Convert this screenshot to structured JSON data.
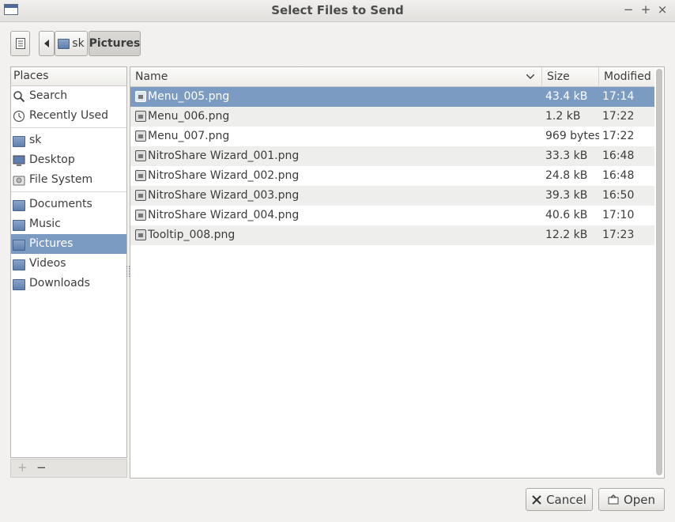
{
  "window": {
    "title": "Select Files to Send",
    "controls": {
      "minimize": "−",
      "maximize": "+",
      "close": "×"
    }
  },
  "toolbar": {
    "location_toggle_icon": "text-entry-icon",
    "back_icon": "left-arrow-icon",
    "path": [
      {
        "label": "sk",
        "icon": "folder-icon"
      },
      {
        "label": "Pictures",
        "active": true
      }
    ]
  },
  "places": {
    "header": "Places",
    "groups": [
      [
        {
          "label": "Search",
          "icon": "search-icon"
        },
        {
          "label": "Recently Used",
          "icon": "clock-icon"
        }
      ],
      [
        {
          "label": "sk",
          "icon": "home-folder-icon"
        },
        {
          "label": "Desktop",
          "icon": "desktop-icon"
        },
        {
          "label": "File System",
          "icon": "drive-icon"
        }
      ],
      [
        {
          "label": "Documents",
          "icon": "folder-icon"
        },
        {
          "label": "Music",
          "icon": "folder-icon"
        },
        {
          "label": "Pictures",
          "icon": "folder-icon",
          "selected": true
        },
        {
          "label": "Videos",
          "icon": "folder-icon"
        },
        {
          "label": "Downloads",
          "icon": "folder-icon"
        }
      ]
    ],
    "footer": {
      "add": "+",
      "remove": "−"
    }
  },
  "files": {
    "columns": {
      "name": "Name",
      "size": "Size",
      "modified": "Modified"
    },
    "rows": [
      {
        "name": "Menu_005.png",
        "size": "43.4 kB",
        "modified": "17:14",
        "selected": true
      },
      {
        "name": "Menu_006.png",
        "size": "1.2 kB",
        "modified": "17:22"
      },
      {
        "name": "Menu_007.png",
        "size": "969 bytes",
        "modified": "17:22"
      },
      {
        "name": "NitroShare Wizard_001.png",
        "size": "33.3 kB",
        "modified": "16:48"
      },
      {
        "name": "NitroShare Wizard_002.png",
        "size": "24.8 kB",
        "modified": "16:48"
      },
      {
        "name": "NitroShare Wizard_003.png",
        "size": "39.3 kB",
        "modified": "16:50"
      },
      {
        "name": "NitroShare Wizard_004.png",
        "size": "40.6 kB",
        "modified": "17:10"
      },
      {
        "name": "Tooltip_008.png",
        "size": "12.2 kB",
        "modified": "17:23"
      }
    ]
  },
  "actions": {
    "cancel": {
      "label": "Cancel",
      "icon": "x-icon"
    },
    "open": {
      "label": "Open",
      "icon": "open-icon"
    }
  },
  "colors": {
    "selection": "#7c9bc3",
    "window_bg": "#f2f1f0"
  }
}
